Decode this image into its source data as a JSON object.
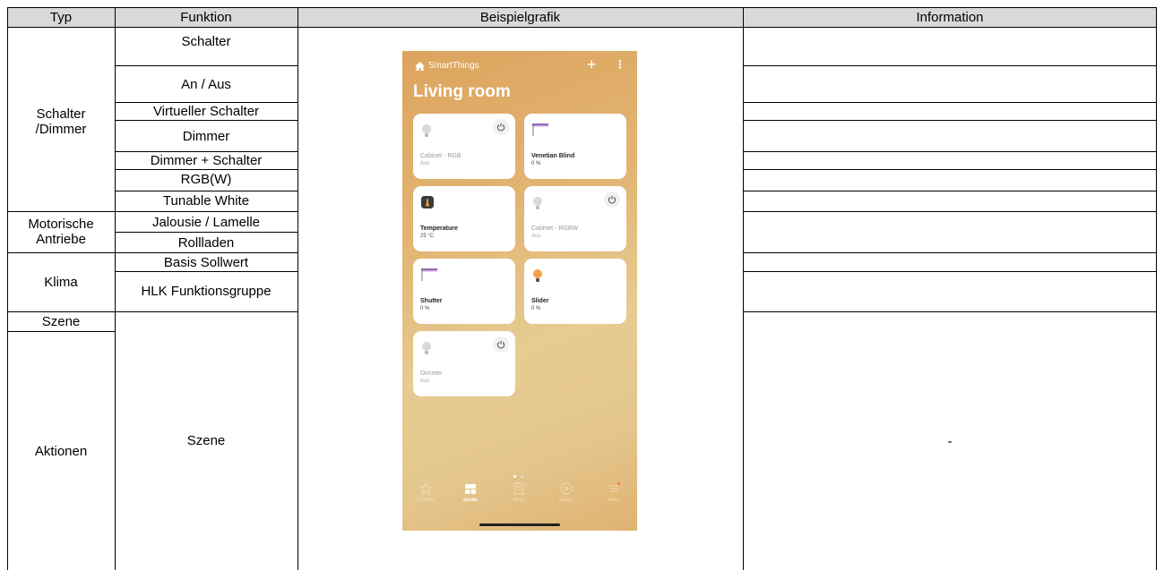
{
  "headers": {
    "typ": "Typ",
    "funktion": "Funktion",
    "beispielgrafik": "Beispielgrafik",
    "information": "Information"
  },
  "types": {
    "schalter_dimmer": "Schalter /Dimmer",
    "motorische_antriebe": "Motorische Antriebe",
    "klima": "Klima",
    "szene": "Szene",
    "aktionen": "Aktionen"
  },
  "functions": {
    "schalter": "Schalter",
    "an_aus": "An / Aus",
    "virtueller_schalter": "Virtueller Schalter",
    "dimmer": "Dimmer",
    "dimmer_schalter": "Dimmer + Schalter",
    "rgbw": "RGB(W)",
    "tunable_white": "Tunable White",
    "jalousie": "Jalousie / Lamelle",
    "rollladen": "Rollladen",
    "basis_sollwert": "Basis Sollwert",
    "hlk": "HLK Funktionsgruppe",
    "szene": "Szene"
  },
  "information": {
    "aktionen": "-"
  },
  "phone": {
    "brand": "SmartThings",
    "add": "+",
    "more": "⋮",
    "room": "Living room",
    "cards": [
      {
        "name": "Cabinet - RGB",
        "value": "Aus",
        "icon": "bulb-icon",
        "power": true,
        "on": false
      },
      {
        "name": "Venetian Blind",
        "value": "0 %",
        "icon": "blind-icon",
        "power": false,
        "on": true
      },
      {
        "name": "Temperature",
        "value": "25 °C",
        "icon": "thermometer-icon",
        "power": false,
        "on": true
      },
      {
        "name": "Cabinet - RGBW",
        "value": "Aus",
        "icon": "bulb-icon",
        "power": true,
        "on": false
      },
      {
        "name": "Shutter",
        "value": "0 %",
        "icon": "blind-icon",
        "power": false,
        "on": true
      },
      {
        "name": "Slider",
        "value": "0 %",
        "icon": "bulb-on-icon",
        "power": false,
        "on": true
      },
      {
        "name": "Dimmer",
        "value": "Aus",
        "icon": "bulb-icon",
        "power": true,
        "on": false
      }
    ],
    "nav": [
      {
        "label": "Favoriten",
        "icon": "star-icon",
        "active": false
      },
      {
        "label": "Geräte",
        "icon": "devices-icon",
        "active": true
      },
      {
        "label": "Alltag",
        "icon": "routine-icon",
        "active": false
      },
      {
        "label": "Regeln",
        "icon": "play-icon",
        "active": false
      },
      {
        "label": "Menü",
        "icon": "menu-icon",
        "active": false
      }
    ],
    "accent": "#f2643c"
  }
}
